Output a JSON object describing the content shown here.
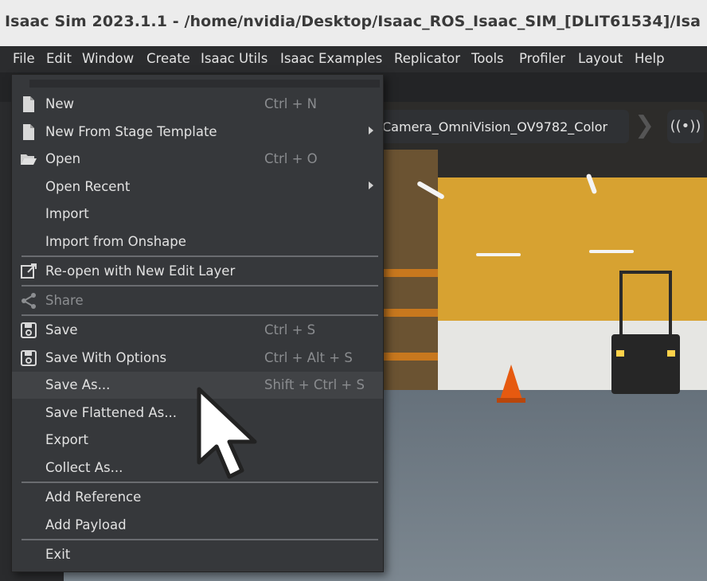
{
  "window": {
    "title": "Isaac Sim 2023.1.1 - /home/nvidia/Desktop/Isaac_ROS_Isaac_SIM_[DLIT61534]/Isa"
  },
  "menubar": {
    "items": [
      "File",
      "Edit",
      "Window",
      "Create",
      "Isaac Utils",
      "Isaac Examples",
      "Replicator",
      "Tools",
      "Profiler",
      "Layout",
      "Help"
    ]
  },
  "viewport": {
    "camera_label": "Camera_OmniVision_OV9782_Color",
    "chevron": "❯",
    "radio_icon": "((•))"
  },
  "file_menu": {
    "new": {
      "label": "New",
      "shortcut": "Ctrl + N"
    },
    "new_from_template": {
      "label": "New From Stage Template"
    },
    "open": {
      "label": "Open",
      "shortcut": "Ctrl + O"
    },
    "open_recent": {
      "label": "Open Recent"
    },
    "import": {
      "label": "Import"
    },
    "import_onshape": {
      "label": "Import from Onshape"
    },
    "reopen": {
      "label": "Re-open with New Edit Layer"
    },
    "share": {
      "label": "Share"
    },
    "save": {
      "label": "Save",
      "shortcut": "Ctrl + S"
    },
    "save_options": {
      "label": "Save With Options",
      "shortcut": "Ctrl + Alt + S"
    },
    "save_as": {
      "label": "Save As...",
      "shortcut": "Shift + Ctrl + S"
    },
    "save_flattened": {
      "label": "Save Flattened As..."
    },
    "export": {
      "label": "Export"
    },
    "collect": {
      "label": "Collect As..."
    },
    "add_reference": {
      "label": "Add Reference"
    },
    "add_payload": {
      "label": "Add Payload"
    },
    "exit": {
      "label": "Exit"
    }
  },
  "colors": {
    "menu_bg": "#36383b",
    "highlight": "#414346",
    "text": "#e2e2e2",
    "shortcut": "#8a8c8f"
  }
}
